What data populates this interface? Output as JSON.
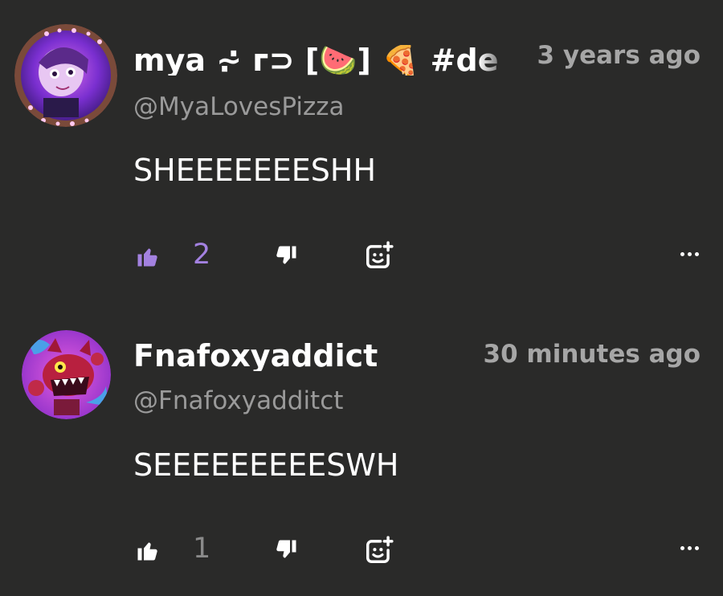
{
  "comments": [
    {
      "display_name": "mya ⩫ ᴦ⊃ [🍉] 🍕 #de",
      "handle": "@MyaLovesPizza",
      "timestamp": "3 years ago",
      "text": "SHEEEEEEESHH",
      "like_count": "2",
      "liked": true,
      "avatar_icon": "anime-girl-avatar-icon",
      "accent_color": "#a381e0"
    },
    {
      "display_name": "Fnafoxyaddict",
      "handle": "@Fnafoxyadditct",
      "timestamp": "30 minutes ago",
      "text": "SEEEEEEEEESWH",
      "like_count": "1",
      "liked": false,
      "avatar_icon": "foxy-animatronic-avatar-icon",
      "accent_color": "#ffffff"
    }
  ],
  "icons": {
    "like": "thumbs-up-icon",
    "dislike": "thumbs-down-icon",
    "react": "add-reaction-icon",
    "more": "more-options-icon"
  }
}
